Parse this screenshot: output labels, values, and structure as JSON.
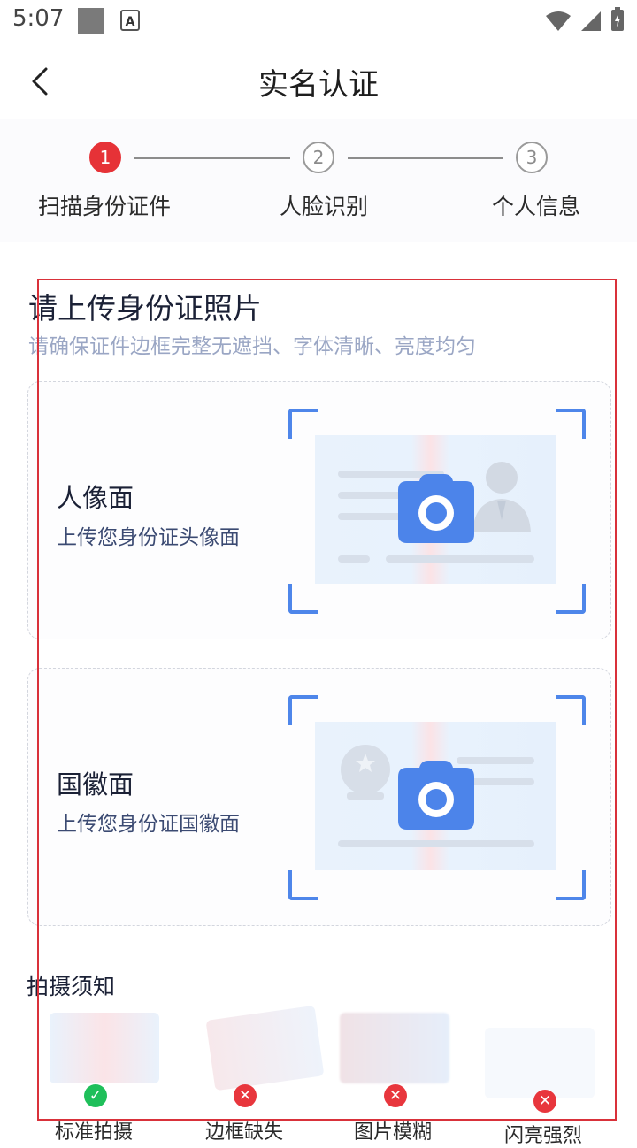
{
  "status": {
    "time": "5:07",
    "a_icon": "A"
  },
  "header": {
    "title": "实名认证"
  },
  "stepper": {
    "steps": [
      {
        "num": "1",
        "label": "扫描身份证件"
      },
      {
        "num": "2",
        "label": "人脸识别"
      },
      {
        "num": "3",
        "label": "个人信息"
      }
    ]
  },
  "upload": {
    "title": "请上传身份证照片",
    "subtitle": "请确保证件边框完整无遮挡、字体清晰、亮度均匀",
    "front": {
      "title": "人像面",
      "sub": "上传您身份证头像面"
    },
    "back": {
      "title": "国徽面",
      "sub": "上传您身份证国徽面"
    }
  },
  "notice": {
    "title": "拍摄须知",
    "items": [
      {
        "label": "标准拍摄",
        "status": "ok"
      },
      {
        "label": "边框缺失",
        "status": "bad"
      },
      {
        "label": "图片模糊",
        "status": "bad"
      },
      {
        "label": "闪亮强烈",
        "status": "bad"
      }
    ]
  },
  "colors": {
    "accent": "#e63237",
    "camera": "#4c84ea",
    "frame": "#4e86ea"
  }
}
